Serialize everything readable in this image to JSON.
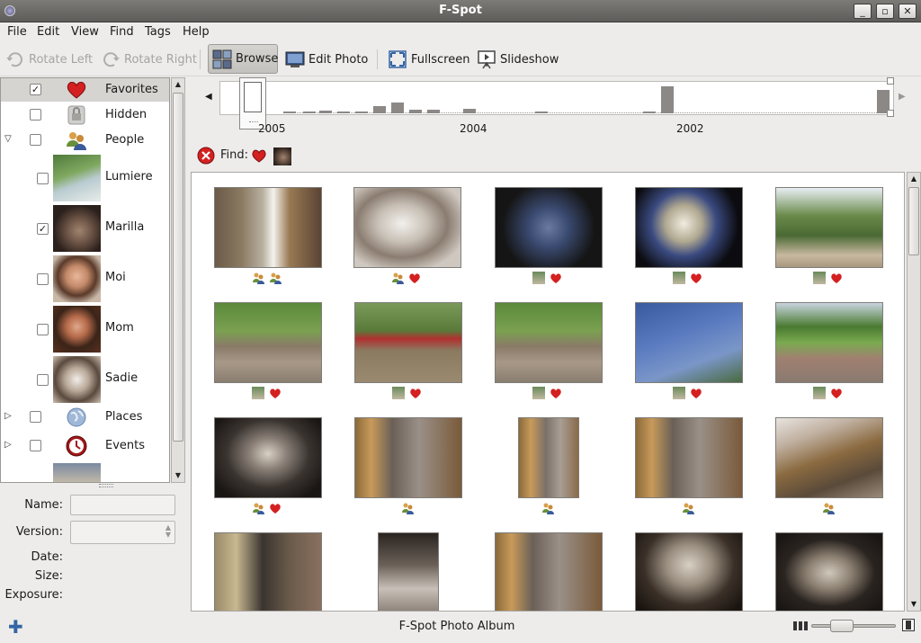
{
  "window": {
    "title": "F-Spot"
  },
  "menu": [
    "File",
    "Edit",
    "View",
    "Find",
    "Tags",
    "Help"
  ],
  "toolbar": {
    "rotate_left": "Rotate Left",
    "rotate_right": "Rotate Right",
    "browse": "Browse",
    "edit_photo": "Edit Photo",
    "fullscreen": "Fullscreen",
    "slideshow": "Slideshow"
  },
  "tags": [
    {
      "label": "Favorites",
      "checked": true,
      "icon": "heart-icon",
      "selected": true
    },
    {
      "label": "Hidden",
      "checked": false,
      "icon": "lock-icon"
    },
    {
      "label": "People",
      "checked": false,
      "icon": "people-icon",
      "expanded": true
    },
    {
      "label": "Lumiere",
      "checked": false,
      "icon": "person-thumb"
    },
    {
      "label": "Marilla",
      "checked": true,
      "icon": "person-thumb"
    },
    {
      "label": "Moi",
      "checked": false,
      "icon": "person-thumb"
    },
    {
      "label": "Mom",
      "checked": false,
      "icon": "person-thumb"
    },
    {
      "label": "Sadie",
      "checked": false,
      "icon": "person-thumb"
    },
    {
      "label": "Places",
      "checked": false,
      "icon": "globe-icon",
      "expanded": false
    },
    {
      "label": "Events",
      "checked": false,
      "icon": "clock-icon",
      "expanded": false
    }
  ],
  "info": {
    "name_label": "Name:",
    "version_label": "Version:",
    "date_label": "Date:",
    "size_label": "Size:",
    "exposure_label": "Exposure:",
    "name_value": "",
    "version_value": ""
  },
  "timeline": {
    "years": [
      "2005",
      "2004",
      "2002"
    ]
  },
  "find": {
    "label": "Find:"
  },
  "status": {
    "text": "F-Spot Photo Album"
  },
  "colors": {
    "heart": "#d42020",
    "selection": "#d6d4d1"
  }
}
